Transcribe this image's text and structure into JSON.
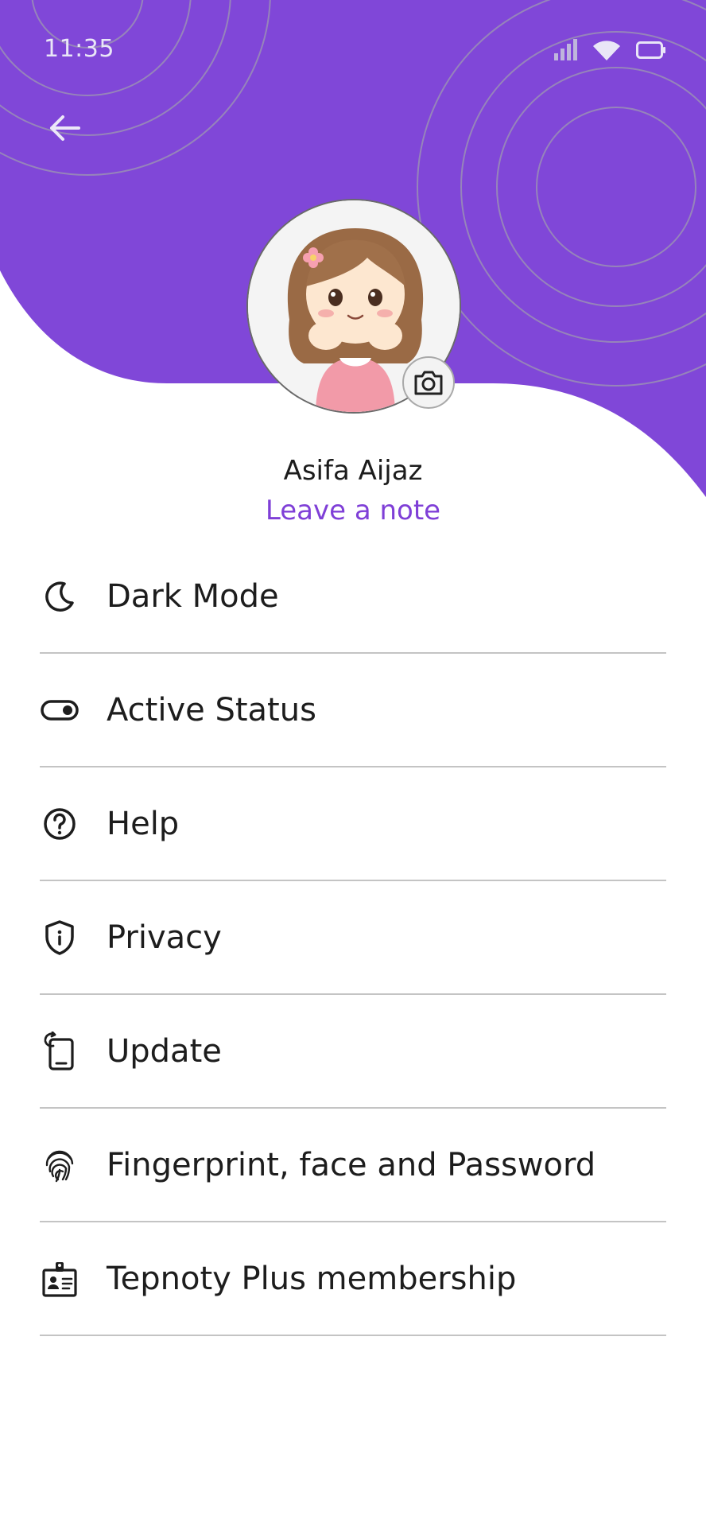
{
  "status_bar": {
    "time": "11:35",
    "icons": [
      "signal-icon",
      "wifi-icon",
      "battery-icon"
    ]
  },
  "colors": {
    "header_purple": "#8047d8",
    "accent": "#7f3fd7",
    "divider": "#c4c4c4"
  },
  "profile": {
    "name": "Asifa Aijaz",
    "note_link": "Leave a note"
  },
  "menu": {
    "items": [
      {
        "label": "Dark Mode",
        "icon": "moon-icon"
      },
      {
        "label": "Active Status",
        "icon": "toggle-icon"
      },
      {
        "label": "Help",
        "icon": "help-icon"
      },
      {
        "label": "Privacy",
        "icon": "shield-icon"
      },
      {
        "label": "Update",
        "icon": "phone-update-icon"
      },
      {
        "label": "Fingerprint, face and Password",
        "icon": "fingerprint-icon"
      },
      {
        "label": "Tepnoty Plus membership",
        "icon": "id-badge-icon"
      }
    ]
  }
}
